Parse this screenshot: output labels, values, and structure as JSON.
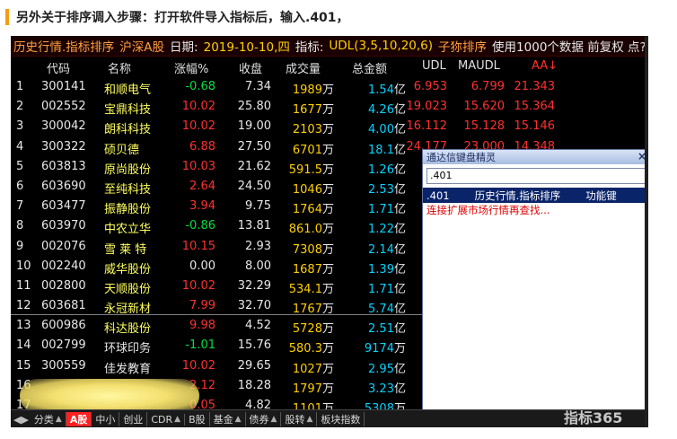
{
  "caption": "另外关于排序调入步骤：打开软件导入指标后，输入.401，",
  "titlebar": {
    "name": "历史行情.指标排序",
    "market": "沪深A股",
    "date_label": "日期:",
    "date_value": "2019-10-10,四",
    "indicator_label": "指标:",
    "indicator_value": "UDL(3,5,10,20,6)",
    "sort": "子狝排序",
    "usage": "使用1000个数据 前复权 点?"
  },
  "columns": [
    "代码",
    "名称",
    "涨幅%",
    "收盘",
    "成交量",
    "总金额",
    "UDL",
    "MAUDL",
    "AA↓"
  ],
  "rows": [
    {
      "idx": "1",
      "code": "300141",
      "name": "和顺电气",
      "chg": "-0.68",
      "close": "7.34",
      "vol": "1989",
      "vol_unit": "万",
      "amt": "1.54",
      "amt_unit": "亿",
      "udl": "6.953",
      "maudl": "6.799",
      "aa": "21.343"
    },
    {
      "idx": "2",
      "code": "002552",
      "name": "宝鼎科技",
      "chg": "10.02",
      "close": "25.80",
      "vol": "1677",
      "vol_unit": "万",
      "amt": "4.26",
      "amt_unit": "亿",
      "udl": "19.023",
      "maudl": "15.620",
      "aa": "15.364"
    },
    {
      "idx": "3",
      "code": "300042",
      "name": "朗科科技",
      "chg": "10.02",
      "close": "19.00",
      "vol": "2103",
      "vol_unit": "万",
      "amt": "4.00",
      "amt_unit": "亿",
      "udl": "16.112",
      "maudl": "15.128",
      "aa": "15.146"
    },
    {
      "idx": "4",
      "code": "300322",
      "name": "硕贝德",
      "chg": "6.88",
      "close": "27.50",
      "vol": "6701",
      "vol_unit": "万",
      "amt": "18.1",
      "amt_unit": "亿",
      "udl": "24.177",
      "maudl": "23.000",
      "aa": "14.348"
    },
    {
      "idx": "5",
      "code": "603813",
      "name": "原尚股份",
      "chg": "10.03",
      "close": "21.62",
      "vol": "591.5",
      "vol_unit": "万",
      "amt": "1.26",
      "amt_unit": "亿",
      "udl": "",
      "maudl": "",
      "aa": ""
    },
    {
      "idx": "6",
      "code": "603690",
      "name": "至纯科技",
      "chg": "2.64",
      "close": "24.50",
      "vol": "1046",
      "vol_unit": "万",
      "amt": "2.53",
      "amt_unit": "亿",
      "udl": "",
      "maudl": "",
      "aa": ""
    },
    {
      "idx": "7",
      "code": "603477",
      "name": "振静股份",
      "chg": "3.94",
      "close": "9.75",
      "vol": "1764",
      "vol_unit": "万",
      "amt": "1.71",
      "amt_unit": "亿",
      "udl": "",
      "maudl": "",
      "aa": ""
    },
    {
      "idx": "8",
      "code": "603970",
      "name": "中农立华",
      "chg": "-0.86",
      "close": "13.81",
      "vol": "861.0",
      "vol_unit": "万",
      "amt": "1.22",
      "amt_unit": "亿",
      "udl": "",
      "maudl": "",
      "aa": ""
    },
    {
      "idx": "9",
      "code": "002076",
      "name": "雪 莱 特",
      "chg": "10.15",
      "close": "2.93",
      "vol": "7308",
      "vol_unit": "万",
      "amt": "2.14",
      "amt_unit": "亿",
      "udl": "",
      "maudl": "",
      "aa": ""
    },
    {
      "idx": "10",
      "code": "002240",
      "name": "威华股份",
      "chg": "0.00",
      "close": "8.00",
      "vol": "1687",
      "vol_unit": "万",
      "amt": "1.39",
      "amt_unit": "亿",
      "udl": "",
      "maudl": "",
      "aa": ""
    },
    {
      "idx": "11",
      "code": "002800",
      "name": "天顺股份",
      "chg": "10.02",
      "close": "32.29",
      "vol": "534.1",
      "vol_unit": "万",
      "amt": "1.71",
      "amt_unit": "亿",
      "udl": "26.",
      "maudl": "",
      "aa": ""
    },
    {
      "idx": "12",
      "code": "603681",
      "name": "永冠新材",
      "chg": "7.99",
      "close": "32.70",
      "vol": "1767",
      "vol_unit": "万",
      "amt": "5.74",
      "amt_unit": "亿",
      "udl": "28.",
      "maudl": "",
      "aa": ""
    },
    {
      "idx": "13",
      "code": "600986",
      "name": "科达股份",
      "chg": "9.98",
      "close": "4.52",
      "vol": "5728",
      "vol_unit": "万",
      "amt": "2.51",
      "amt_unit": "亿",
      "udl": "",
      "maudl": "",
      "aa": ""
    },
    {
      "idx": "14",
      "code": "002799",
      "name": "环球印务",
      "chg": "-1.01",
      "close": "15.76",
      "vol": "580.3",
      "vol_unit": "万",
      "amt": "9174",
      "amt_unit": "万",
      "udl": "",
      "maudl": "",
      "aa": ""
    },
    {
      "idx": "15",
      "code": "300559",
      "name": "佳发教育",
      "chg": "10.02",
      "close": "29.65",
      "vol": "1027",
      "vol_unit": "万",
      "amt": "2.95",
      "amt_unit": "亿",
      "udl": "",
      "maudl": "",
      "aa": ""
    },
    {
      "idx": "16",
      "code": "",
      "name": "",
      "chg": "2.12",
      "close": "18.28",
      "vol": "1797",
      "vol_unit": "万",
      "amt": "3.23",
      "amt_unit": "亿",
      "udl": "",
      "maudl": "",
      "aa": ""
    },
    {
      "idx": "17",
      "code": "",
      "name": "",
      "chg": "0.05",
      "close": "4.82",
      "vol": "1101",
      "vol_unit": "万",
      "amt": "5308",
      "amt_unit": "万",
      "udl": "",
      "maudl": "",
      "aa": ""
    },
    {
      "idx": "18",
      "code": "603360",
      "name": "百傲化学",
      "chg": "2.20",
      "close": "36.20",
      "vol": "442.0",
      "vol_unit": "万",
      "amt": "1.59",
      "amt_unit": "亿",
      "udl": "33.",
      "maudl": "",
      "aa": ""
    }
  ],
  "popup": {
    "title": "通达信键盘精灵",
    "close": "×",
    "input_value": ".401",
    "result_code": ".401",
    "result_name": "历史行情.指标排序",
    "result_type": "功能键",
    "hint": "连接扩展市场行情再查找..."
  },
  "tabs": [
    {
      "label": "分类",
      "dropdown": true,
      "active": false
    },
    {
      "label": "A股",
      "dropdown": false,
      "active": true
    },
    {
      "label": "中小",
      "dropdown": false,
      "active": false
    },
    {
      "label": "创业",
      "dropdown": false,
      "active": false
    },
    {
      "label": "CDR",
      "dropdown": true,
      "active": false
    },
    {
      "label": "B股",
      "dropdown": false,
      "active": false
    },
    {
      "label": "基金",
      "dropdown": true,
      "active": false
    },
    {
      "label": "债券",
      "dropdown": true,
      "active": false
    },
    {
      "label": "股转",
      "dropdown": true,
      "active": false
    },
    {
      "label": "板块指数",
      "dropdown": false,
      "active": false
    }
  ],
  "watermark": "指标365",
  "colors": {
    "up": "#ff3030",
    "down": "#00e040",
    "volume": "#ffd000",
    "amount": "#00d4ff",
    "active_tab": "#ff2020"
  }
}
